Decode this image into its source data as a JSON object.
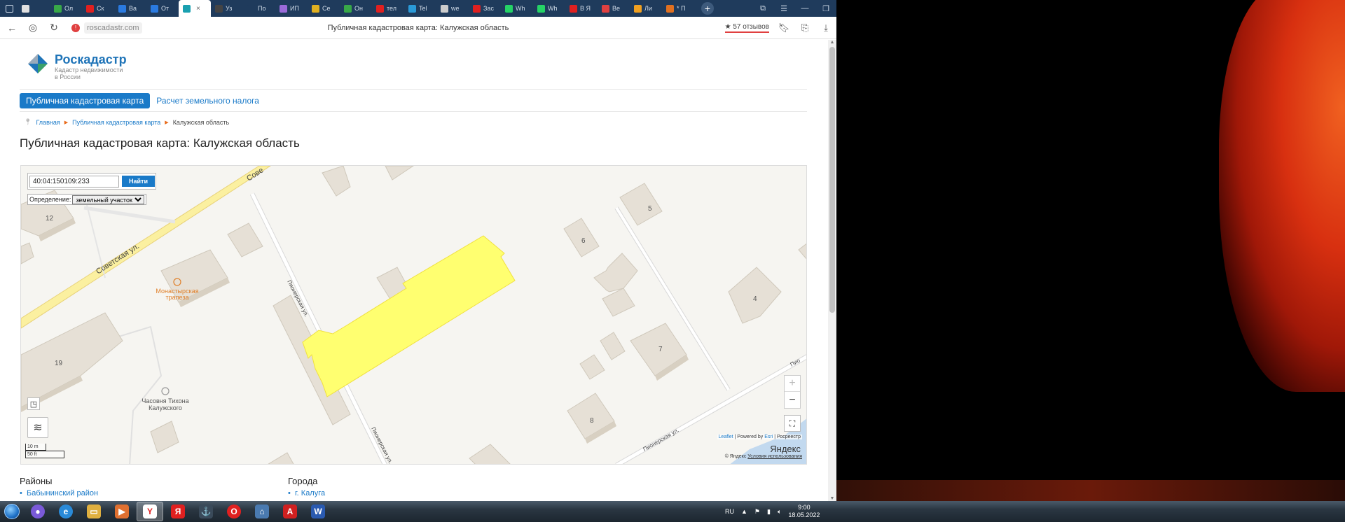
{
  "browser": {
    "tabs": [
      {
        "label": "",
        "color": "#e0e0e0",
        "active": false
      },
      {
        "label": "Ол",
        "color": "#38a848",
        "active": false
      },
      {
        "label": "Ск",
        "color": "#e02020",
        "active": false
      },
      {
        "label": "Ва",
        "color": "#2a7ae0",
        "active": false
      },
      {
        "label": "От",
        "color": "#2a7ae0",
        "active": false
      },
      {
        "label": "",
        "color": "#1aa0b0",
        "active": true
      },
      {
        "label": "Уз",
        "color": "#444",
        "active": false
      },
      {
        "label": "По",
        "color": "#1f3b5c",
        "active": false
      },
      {
        "label": "ИП",
        "color": "#9a6ad8",
        "active": false
      },
      {
        "label": "Се",
        "color": "#e0b020",
        "active": false
      },
      {
        "label": "Он",
        "color": "#38a848",
        "active": false
      },
      {
        "label": "тел",
        "color": "#e02020",
        "active": false
      },
      {
        "label": "Tel",
        "color": "#2a9ad8",
        "active": false
      },
      {
        "label": "we",
        "color": "#ccc",
        "active": false
      },
      {
        "label": "Зас",
        "color": "#e02020",
        "active": false
      },
      {
        "label": "Wh",
        "color": "#25d366",
        "active": false
      },
      {
        "label": "Wh",
        "color": "#25d366",
        "active": false
      },
      {
        "label": "В Я",
        "color": "#e02020",
        "active": false
      },
      {
        "label": "Ве",
        "color": "#e04040",
        "active": false
      },
      {
        "label": "Ли",
        "color": "#f0a020",
        "active": false
      },
      {
        "label": "* П",
        "color": "#e07020",
        "active": false
      }
    ],
    "url": "roscadastr.com",
    "page_title": "Публичная кадастровая карта: Калужская область",
    "reviews": "★ 57 отзывов"
  },
  "site": {
    "logo_name": "Роскадастр",
    "logo_sub1": "Кадастр недвижимости",
    "logo_sub2": "в России",
    "nav_active": "Публичная кадастровая карта",
    "nav_link": "Расчет земельного налога",
    "breadcrumb": [
      "Главная",
      "Публичная кадастровая карта",
      "Калужская область"
    ],
    "heading": "Публичная кадастровая карта: Калужская область"
  },
  "map": {
    "search_value": "40:04:150109:233",
    "search_button": "Найти",
    "definition_label": "Определение:",
    "definition_value": "земельный участок",
    "streets": {
      "sovetskaya": "Советская ул.",
      "sovetskaya_top": "Сове",
      "pionerskaya1": "Пионерская ул.",
      "pionerskaya2": "Пионерская ул.",
      "pionerskaya3": "Пионерская ул.",
      "pionerskaya_right": "Пио"
    },
    "house_numbers": [
      "12",
      "19",
      "5",
      "6",
      "4",
      "7",
      "8"
    ],
    "poi_trapeza": "Монастырская трапеза",
    "poi_chapel": "Часовня Тихона Калужского",
    "scale_m": "10 m",
    "scale_ft": "50 ft",
    "attr_leaflet": "Leaflet",
    "attr_powered": " | Powered by ",
    "attr_esri": "Esri",
    "attr_rosreestr": " | Росреестр",
    "yandex_logo": "Яндекс",
    "yandex_copy": "© Яндекс ",
    "yandex_terms": "Условия использования",
    "highlight_color": "#ffff70"
  },
  "sections": {
    "districts_title": "Районы",
    "districts_first": "Бабынинский район",
    "cities_title": "Города",
    "cities_first": "г. Калуга"
  },
  "taskbar": {
    "lang": "RU",
    "time": "9:00",
    "date": "18.05.2022"
  }
}
